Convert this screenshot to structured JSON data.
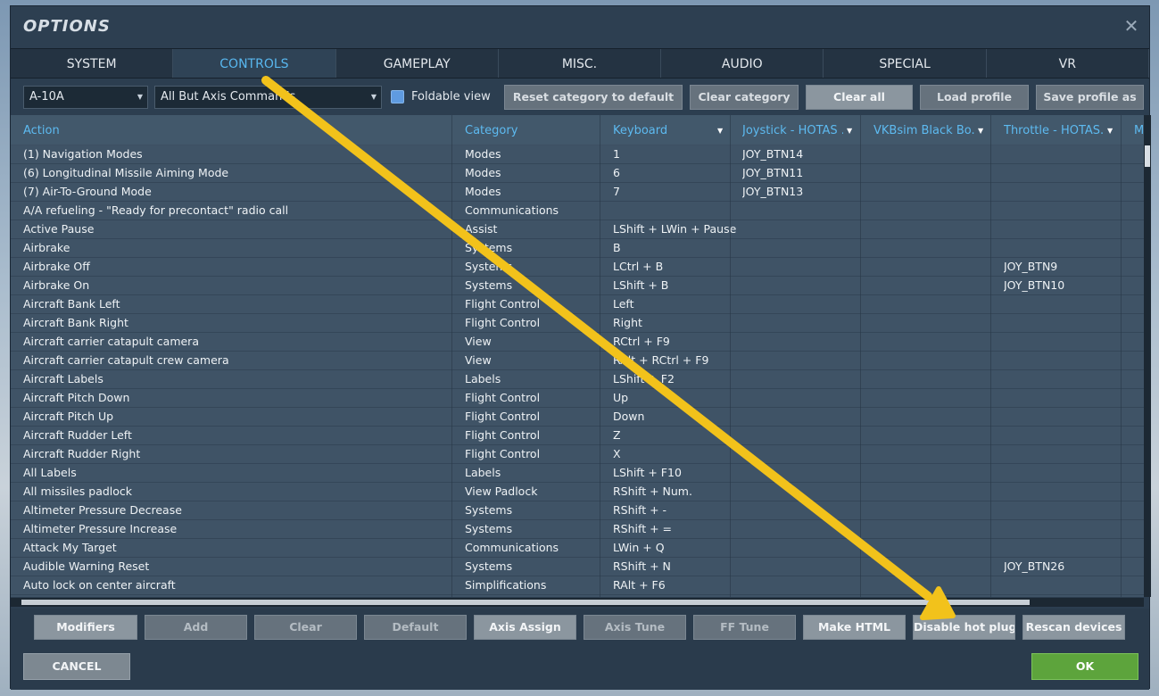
{
  "window": {
    "title": "OPTIONS"
  },
  "tabs": [
    "SYSTEM",
    "CONTROLS",
    "GAMEPLAY",
    "MISC.",
    "AUDIO",
    "SPECIAL",
    "VR"
  ],
  "toolbar": {
    "aircraft": "A-10A",
    "filter": "All But Axis Commands",
    "foldable_label": "Foldable view",
    "reset_label": "Reset category to default",
    "clear_category_label": "Clear category",
    "clear_all_label": "Clear all",
    "load_profile_label": "Load profile",
    "save_profile_label": "Save profile as"
  },
  "grid": {
    "headers": [
      "Action",
      "Category",
      "Keyboard",
      "Joystick - HOTAS ...",
      "VKBsim Black Bo...",
      "Throttle - HOTAS...",
      "M"
    ],
    "rows": [
      [
        "(1) Navigation Modes",
        "Modes",
        "1",
        "JOY_BTN14",
        "",
        ""
      ],
      [
        "(6) Longitudinal Missile Aiming Mode",
        "Modes",
        "6",
        "JOY_BTN11",
        "",
        ""
      ],
      [
        "(7) Air-To-Ground Mode",
        "Modes",
        "7",
        "JOY_BTN13",
        "",
        ""
      ],
      [
        "A/A refueling - \"Ready for precontact\" radio call",
        "Communications",
        "",
        "",
        "",
        ""
      ],
      [
        "Active Pause",
        "Assist",
        "LShift + LWin + Pause",
        "",
        "",
        ""
      ],
      [
        "Airbrake",
        "Systems",
        "B",
        "",
        "",
        ""
      ],
      [
        "Airbrake Off",
        "Systems",
        "LCtrl + B",
        "",
        "",
        "JOY_BTN9"
      ],
      [
        "Airbrake On",
        "Systems",
        "LShift + B",
        "",
        "",
        "JOY_BTN10"
      ],
      [
        "Aircraft Bank Left",
        "Flight Control",
        "Left",
        "",
        "",
        ""
      ],
      [
        "Aircraft Bank Right",
        "Flight Control",
        "Right",
        "",
        "",
        ""
      ],
      [
        "Aircraft carrier catapult camera",
        "View",
        "RCtrl + F9",
        "",
        "",
        ""
      ],
      [
        "Aircraft carrier catapult crew camera",
        "View",
        "RAlt + RCtrl + F9",
        "",
        "",
        ""
      ],
      [
        "Aircraft Labels",
        "Labels",
        "LShift + F2",
        "",
        "",
        ""
      ],
      [
        "Aircraft Pitch Down",
        "Flight Control",
        "Up",
        "",
        "",
        ""
      ],
      [
        "Aircraft Pitch Up",
        "Flight Control",
        "Down",
        "",
        "",
        ""
      ],
      [
        "Aircraft Rudder Left",
        "Flight Control",
        "Z",
        "",
        "",
        ""
      ],
      [
        "Aircraft Rudder Right",
        "Flight Control",
        "X",
        "",
        "",
        ""
      ],
      [
        "All Labels",
        "Labels",
        "LShift + F10",
        "",
        "",
        ""
      ],
      [
        "All missiles padlock",
        "View Padlock",
        "RShift + Num.",
        "",
        "",
        ""
      ],
      [
        "Altimeter Pressure Decrease",
        "Systems",
        "RShift + -",
        "",
        "",
        ""
      ],
      [
        "Altimeter Pressure Increase",
        "Systems",
        "RShift + =",
        "",
        "",
        ""
      ],
      [
        "Attack My Target",
        "Communications",
        "LWin + Q",
        "",
        "",
        ""
      ],
      [
        "Audible Warning Reset",
        "Systems",
        "RShift + N",
        "",
        "",
        "JOY_BTN26"
      ],
      [
        "Auto lock on center aircraft",
        "Simplifications",
        "RAlt + F6",
        "",
        "",
        ""
      ]
    ]
  },
  "bottom_buttons": [
    "Modifiers",
    "Add",
    "Clear",
    "Default",
    "Axis Assign",
    "Axis Tune",
    "FF Tune",
    "Make HTML",
    "Disable hot plug",
    "Rescan devices"
  ],
  "footer": {
    "cancel_label": "CANCEL",
    "ok_label": "OK"
  },
  "colors": {
    "accent": "#58b7ef",
    "ok": "#5da43c",
    "annotation_arrow": "#f2c21b"
  }
}
